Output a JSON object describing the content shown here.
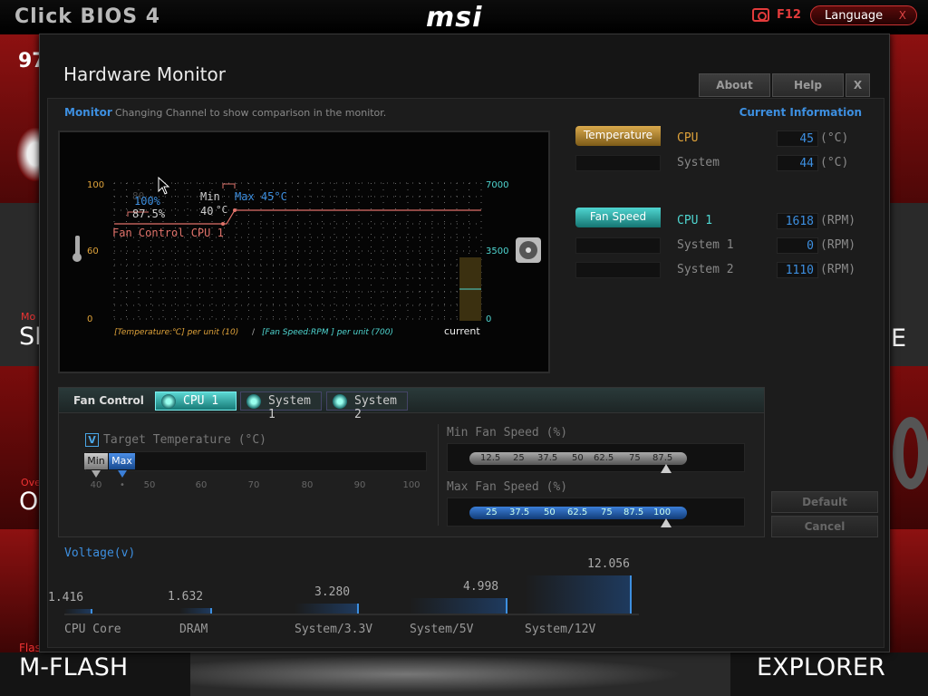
{
  "header": {
    "bios_title": "Click BIOS 4",
    "logo": "msi",
    "screenshot_key": "F12",
    "language_button": "Language",
    "language_close": "X"
  },
  "background": {
    "left_partial_top": "97",
    "left_partial_mo": "Mo",
    "left_si": "SI",
    "left_over": "Ove",
    "left_o": "O",
    "left_flash": "Flas",
    "m_flash": "M-FLASH",
    "explorer": "EXPLORER",
    "right_e": "E"
  },
  "dialog": {
    "title": "Hardware Monitor",
    "buttons": {
      "about": "About",
      "help": "Help",
      "close": "X"
    },
    "monitor_label": "Monitor",
    "monitor_hint": "Changing Channel to show comparison in the monitor.",
    "current_info_label": "Current  Information"
  },
  "monitor": {
    "y_left": [
      "100",
      "60",
      "0"
    ],
    "y_right": [
      "7000",
      "3500",
      "0"
    ],
    "fade_percent": "80",
    "pct_100": "100%",
    "pct_875": "87.5%",
    "min_label": "Min",
    "min_temp": "40",
    "deg": "°C",
    "max_label": "Max 45°C",
    "fan_control_label": "Fan Control  CPU 1",
    "unit_temp": "[Temperature:℃] per unit (10)",
    "unit_sep": "/",
    "unit_fan": "[Fan Speed:RPM ] per unit (700)",
    "current_label": "current"
  },
  "current_info": {
    "temperature_tag": "Temperature",
    "temperature": [
      {
        "name": "CPU",
        "value": "45",
        "unit": "(°C)"
      },
      {
        "name": "System",
        "value": "44",
        "unit": "(°C)"
      }
    ],
    "fan_tag": "Fan Speed",
    "fans": [
      {
        "name": "CPU 1",
        "value": "1618",
        "unit": "(RPM)"
      },
      {
        "name": "System 1",
        "value": "0",
        "unit": "(RPM)"
      },
      {
        "name": "System 2",
        "value": "1110",
        "unit": "(RPM)"
      }
    ]
  },
  "fan_control": {
    "title": "Fan Control",
    "tabs": [
      "CPU 1",
      "System 1",
      "System 2"
    ],
    "target_check": "V",
    "target_label": "Target Temperature (°C)",
    "min_handle": "Min",
    "max_handle": "Max",
    "temp_ticks": [
      "40",
      "•",
      "50",
      "60",
      "70",
      "80",
      "90",
      "100"
    ],
    "min_speed_label": "Min Fan Speed (%)",
    "min_speed_ticks": [
      "12.5",
      "25",
      "37.5",
      "50",
      "62.5",
      "75",
      "87.5"
    ],
    "max_speed_label": "Max Fan Speed (%)",
    "max_speed_ticks": [
      "25",
      "37.5",
      "50",
      "62.5",
      "75",
      "87.5",
      "100"
    ],
    "default_button": "Default",
    "cancel_button": "Cancel"
  },
  "voltage": {
    "title": "Voltage(v)",
    "items": [
      {
        "name": "CPU Core",
        "value": 1.416,
        "value_text": "1.416"
      },
      {
        "name": "DRAM",
        "value": 1.632,
        "value_text": "1.632"
      },
      {
        "name": "System/3.3V",
        "value": 3.28,
        "value_text": "3.280"
      },
      {
        "name": "System/5V",
        "value": 4.998,
        "value_text": "4.998"
      },
      {
        "name": "System/12V",
        "value": 12.056,
        "value_text": "12.056"
      }
    ]
  },
  "colors": {
    "accent_blue": "#3d8fe0",
    "temp_gold": "#e0a33a",
    "fan_teal": "#4fd6d1",
    "msi_red": "#c31818"
  }
}
